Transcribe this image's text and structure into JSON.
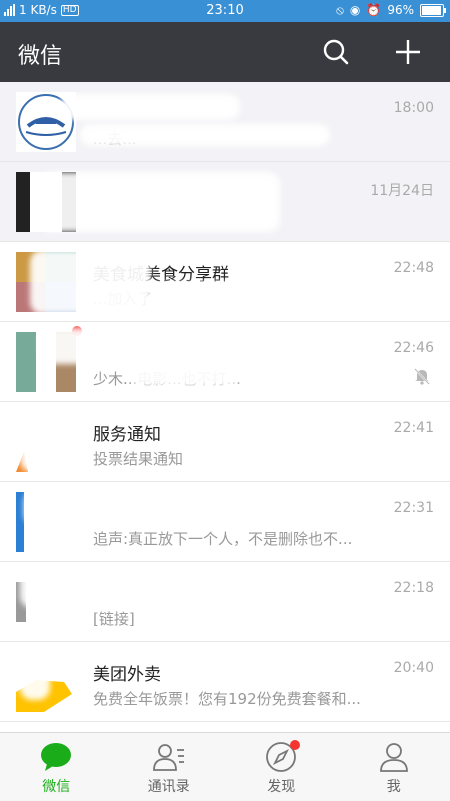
{
  "status_bar": {
    "network": "4G",
    "speed": "1 KB/s",
    "hd": "HD",
    "time": "23:10",
    "battery": "96%",
    "battery_level": 0.96
  },
  "header": {
    "title": "微信"
  },
  "chats": [
    {
      "name": "",
      "time": "18:00",
      "preview": "...去...",
      "muted": false
    },
    {
      "name": "",
      "time": "11月24日",
      "preview": "",
      "muted": false
    },
    {
      "name": "美食城美食分享群",
      "time": "22:48",
      "preview": "...加入了",
      "muted": false
    },
    {
      "name": "",
      "time": "22:46",
      "preview": "少木...电影...也不打...",
      "muted": true
    },
    {
      "name": "服务通知",
      "time": "22:41",
      "preview": "投票结果通知",
      "muted": false
    },
    {
      "name": "",
      "time": "22:31",
      "preview": "追声:真正放下一个人，不是删除也不...",
      "muted": false
    },
    {
      "name": "",
      "time": "22:18",
      "preview": "[链接]",
      "muted": false
    },
    {
      "name": "美团外卖",
      "time": "20:40",
      "preview": "免费全年饭票！您有192份免费套餐和...",
      "muted": false
    }
  ],
  "tabs": [
    {
      "label": "微信",
      "icon": "chat-bubble-icon",
      "active": true
    },
    {
      "label": "通讯录",
      "icon": "contacts-icon",
      "active": false
    },
    {
      "label": "发现",
      "icon": "compass-icon",
      "active": false,
      "badge": true
    },
    {
      "label": "我",
      "icon": "person-icon",
      "active": false
    }
  ],
  "colors": {
    "header_bg": "#393a3f",
    "status_bg": "#3a90d4",
    "accent_green": "#1aad19",
    "badge_red": "#f43530"
  }
}
